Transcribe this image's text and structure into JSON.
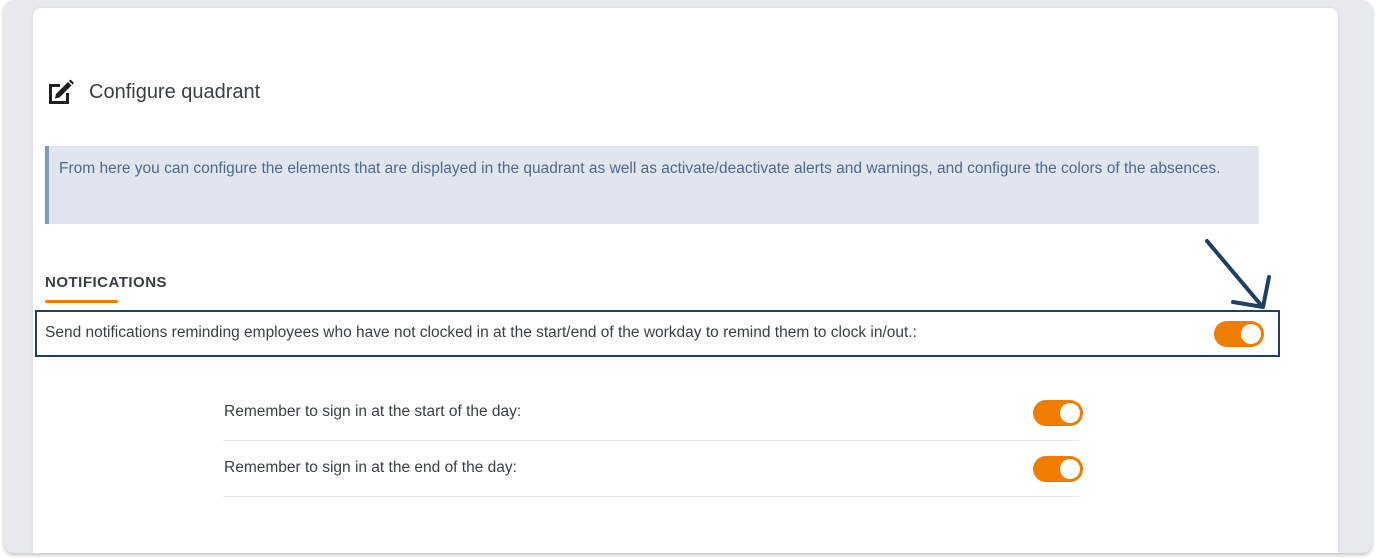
{
  "page": {
    "title": "Configure quadrant",
    "title_icon": "edit-icon",
    "info_text": "From here you can configure the elements that are displayed in the quadrant as well as activate/deactivate alerts and warnings, and configure the colors of the absences."
  },
  "notifications": {
    "section_title": "NOTIFICATIONS",
    "main_setting": {
      "label": "Send notifications reminding employees who have not clocked in at the start/end of the workday to remind them to clock in/out.:",
      "enabled": true
    },
    "sub_settings": [
      {
        "label": "Remember to sign in at the start of the day:",
        "enabled": true
      },
      {
        "label": "Remember to sign in at the end of the day:",
        "enabled": true
      }
    ]
  },
  "colors": {
    "accent": "#f07d00",
    "highlight_border": "#213f5f",
    "info_background": "#e1e5ee",
    "info_border": "#7f9bbd",
    "info_text": "#4a6a91",
    "annotation_arrow": "#213f5f"
  },
  "annotation": {
    "icon": "arrow-down-right-icon"
  }
}
